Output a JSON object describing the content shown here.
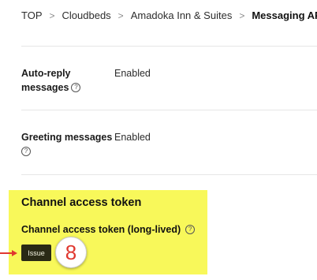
{
  "breadcrumb": {
    "items": [
      "TOP",
      "Cloudbeds",
      "Amadoka Inn & Suites",
      "Messaging API"
    ],
    "separator": ">"
  },
  "settings": {
    "auto_reply": {
      "label_line1": "Auto-reply",
      "label_line2": "messages",
      "value": "Enabled"
    },
    "greeting": {
      "label": "Greeting messages",
      "value": "Enabled"
    }
  },
  "help_icon_glyph": "?",
  "channel_access_token": {
    "title": "Channel access token",
    "long_lived_label": "Channel access token (long-lived)",
    "issue_button": "Issue"
  },
  "annotation": {
    "step_number": "8",
    "highlight_color": "#f8f85a",
    "arrow_color": "#e0382f",
    "badge_text_color": "#e0382f"
  }
}
